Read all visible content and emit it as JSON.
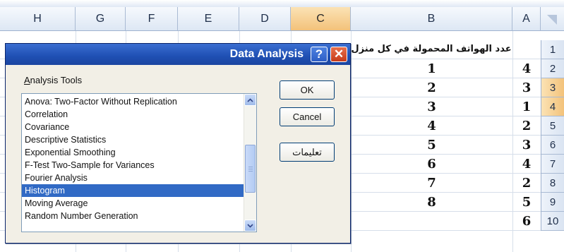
{
  "columns": [
    "H",
    "G",
    "F",
    "E",
    "D",
    "C",
    "B",
    "A"
  ],
  "selected_column": "C",
  "rows": [
    "1",
    "2",
    "3",
    "4",
    "5",
    "6",
    "7",
    "8",
    "9",
    "10"
  ],
  "selected_rows": [
    "3",
    "4"
  ],
  "column_b_header": "عدد الهواتف المحمولة في كل منزل",
  "column_b_values": [
    "1",
    "2",
    "3",
    "4",
    "5",
    "6",
    "7",
    "8"
  ],
  "column_a_values": [
    "4",
    "3",
    "1",
    "2",
    "3",
    "4",
    "2",
    "5",
    "6"
  ],
  "dialog": {
    "title": "Data Analysis",
    "help_glyph": "?",
    "close_glyph": "✕",
    "tools_label_underlined": "A",
    "tools_label_rest": "nalysis Tools",
    "tools": [
      "Anova: Two-Factor Without Replication",
      "Correlation",
      "Covariance",
      "Descriptive Statistics",
      "Exponential Smoothing",
      "F-Test Two-Sample for Variances",
      "Fourier Analysis",
      "Histogram",
      "Moving Average",
      "Random Number Generation"
    ],
    "selected_tool": "Histogram",
    "ok_label": "OK",
    "cancel_label": "Cancel",
    "help_label": "تعليمات"
  },
  "colors": {
    "title_bar": "#2456be",
    "selection": "#316ac5",
    "header_selected": "#f3c27a"
  }
}
